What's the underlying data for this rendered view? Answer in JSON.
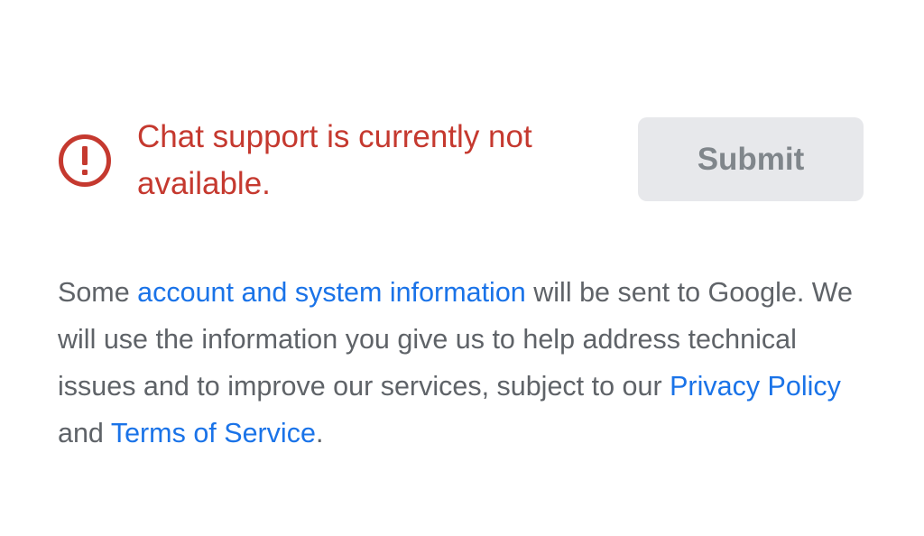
{
  "status": {
    "icon": "error-icon",
    "message": "Chat support is currently not available.",
    "color": "#c5392f"
  },
  "submit": {
    "label": "Submit",
    "enabled": false
  },
  "disclaimer": {
    "prefix": "Some ",
    "account_link": "account and system information",
    "middle": " will be sent to Google. We will use the information you give us to help address technical issues and to improve our services, subject to our ",
    "privacy_link": "Privacy Policy",
    "conjunction": " and ",
    "terms_link": "Terms of Service",
    "suffix": "."
  },
  "colors": {
    "link": "#1a73e8",
    "body_text": "#5f6368",
    "button_bg": "#e7e8eb",
    "button_text": "#80868b"
  }
}
